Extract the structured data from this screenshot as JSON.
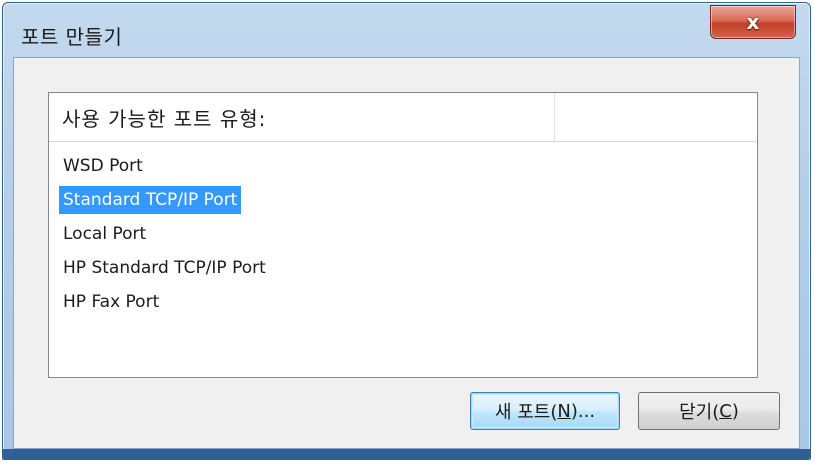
{
  "window": {
    "title": "포트 만들기",
    "close_glyph": "x"
  },
  "listbox": {
    "header": "사용 가능한 포트 유형:",
    "items": [
      {
        "label": "WSD Port",
        "selected": false
      },
      {
        "label": "Standard TCP/IP Port",
        "selected": true
      },
      {
        "label": "Local Port",
        "selected": false
      },
      {
        "label": "HP Standard TCP/IP Port",
        "selected": false
      },
      {
        "label": "HP Fax Port",
        "selected": false
      }
    ]
  },
  "buttons": {
    "new_port_prefix": "새 포트(",
    "new_port_mnemonic": "N",
    "new_port_suffix": ")...",
    "close_prefix": "닫기(",
    "close_mnemonic": "C",
    "close_suffix": ")"
  },
  "colors": {
    "selection": "#3399ff",
    "close_button": "#c3402a",
    "frame": "#b5cfe8"
  }
}
